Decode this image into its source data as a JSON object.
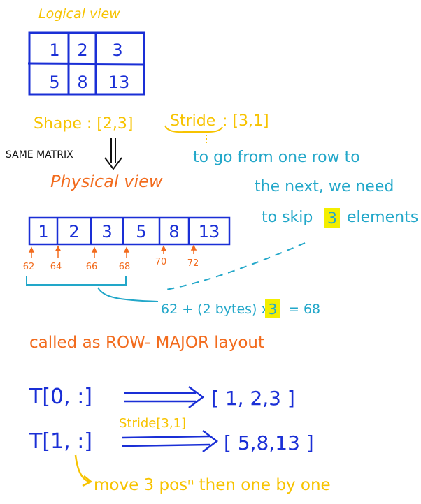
{
  "colors": {
    "blue": "#1a2fd6",
    "yellow": "#f7c300",
    "orange": "#f26b1d",
    "teal": "#22a7c9",
    "black": "#111111",
    "highlight": "#f3ee00"
  },
  "logical": {
    "title": "Logical view",
    "rows": [
      [
        "1",
        "2",
        "3"
      ],
      [
        "5",
        "8",
        "13"
      ]
    ]
  },
  "shape_label": "Shape : [2,3]",
  "stride_word": "Stride",
  "stride_value": ": [3,1]",
  "same_matrix": "SAME MATRIX",
  "note": {
    "line1": "to go from one row to",
    "line2": "the next, we need",
    "line3_a": "to skip",
    "line3_num": "3",
    "line3_b": "elements"
  },
  "physical": {
    "title": "Physical view",
    "cells": [
      "1",
      "2",
      "3",
      "5",
      "8",
      "13"
    ],
    "addresses": [
      "62",
      "64",
      "66",
      "68",
      "70",
      "72"
    ]
  },
  "formula": {
    "left": "62 + (2 bytes) x",
    "num": "3",
    "right": "= 68"
  },
  "row_major": "called as ROW- MAJOR layout",
  "indexing": {
    "t0": "T[0, :]",
    "t0_result": "[ 1, 2,3 ]",
    "stride_note": "Stride[3,1]",
    "t1": "T[1, :]",
    "t1_result": "[ 5,8,13 ]"
  },
  "bottom_note": "move 3 posⁿ then one by one"
}
